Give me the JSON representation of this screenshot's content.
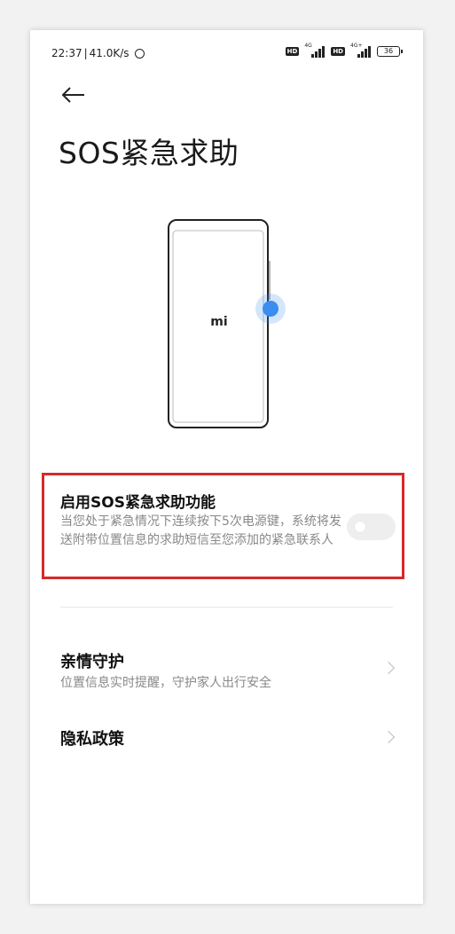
{
  "status_bar": {
    "time": "22:37",
    "separator": "|",
    "net_speed": "41.0K/s",
    "sim1_hd": "HD",
    "sim1_net": "4G",
    "sim2_hd": "HD",
    "sim2_net": "4G+",
    "battery": "36"
  },
  "header": {
    "back_icon": "back-arrow-icon",
    "title": "SOS紧急求助"
  },
  "illustration": {
    "logo_text": "mi"
  },
  "sos_setting": {
    "title": "启用SOS紧急求助功能",
    "description": "当您处于紧急情况下连续按下5次电源键，系统将发送附带位置信息的求助短信至您添加的紧急联系人",
    "enabled": false
  },
  "rows": [
    {
      "title": "亲情守护",
      "subtitle": "位置信息实时提醒，守护家人出行安全"
    },
    {
      "title": "隐私政策"
    }
  ],
  "colors": {
    "highlight_border": "#d42a2a",
    "press_dot": "#3b8df0",
    "toggle_off": "#eeeeee"
  }
}
